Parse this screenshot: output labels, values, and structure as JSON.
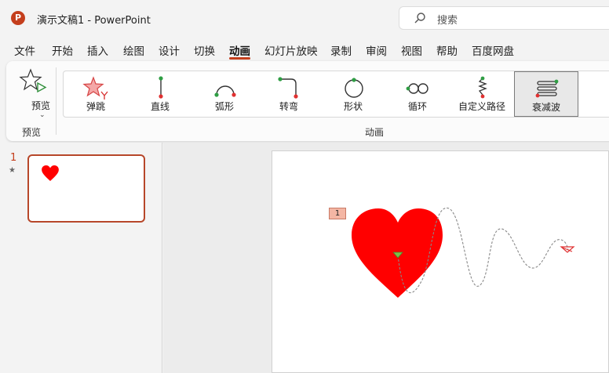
{
  "titlebar": {
    "logo_letter": "P",
    "title": "演示文稿1  -  PowerPoint",
    "search_placeholder": "搜索"
  },
  "menu": {
    "tabs": [
      "文件",
      "开始",
      "插入",
      "绘图",
      "设计",
      "切换",
      "动画",
      "幻灯片放映",
      "录制",
      "审阅",
      "视图",
      "帮助",
      "百度网盘"
    ],
    "active": "动画",
    "accent": "#c43e1c"
  },
  "ribbon": {
    "preview_label": "预览",
    "preview_group_label": "预览",
    "animation_group_label": "动画",
    "animations": [
      {
        "label": "弹跳",
        "icon": "bounce-star-icon"
      },
      {
        "label": "直线",
        "icon": "line-path-icon"
      },
      {
        "label": "弧形",
        "icon": "arc-path-icon"
      },
      {
        "label": "转弯",
        "icon": "turn-path-icon"
      },
      {
        "label": "形状",
        "icon": "shape-path-icon"
      },
      {
        "label": "循环",
        "icon": "loop-path-icon"
      },
      {
        "label": "自定义路径",
        "icon": "custom-path-icon"
      },
      {
        "label": "衰减波",
        "icon": "decay-wave-icon"
      }
    ],
    "selected_animation": "衰减波"
  },
  "slides_panel": {
    "slide_number": "1",
    "star": "★"
  },
  "slide": {
    "animation_tag": "1",
    "heart_color": "#ff0000"
  }
}
